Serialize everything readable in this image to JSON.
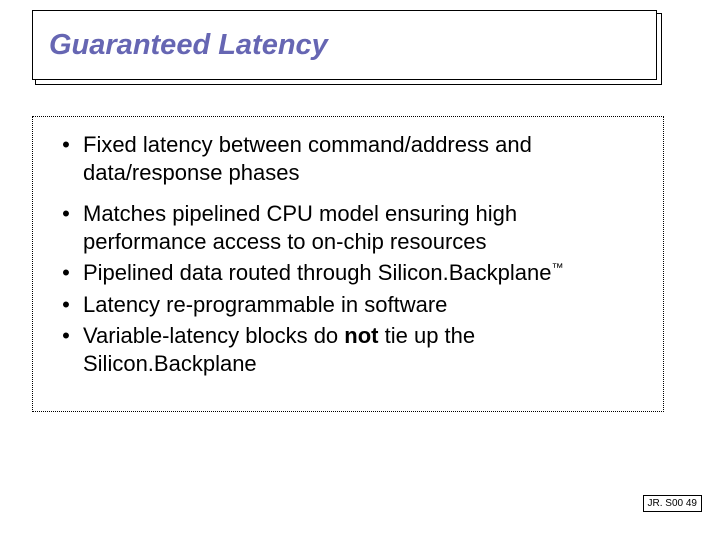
{
  "title": "Guaranteed Latency",
  "bullets": [
    {
      "pre": "Fixed latency between command/address and data/response phases",
      "bold": "",
      "post": "",
      "tm": false,
      "tight": false
    },
    {
      "pre": "Matches pipelined CPU model ensuring high performance access to on-chip resources",
      "bold": "",
      "post": "",
      "tm": false,
      "tight": true
    },
    {
      "pre": "Pipelined data routed through Silicon.Backplane",
      "bold": "",
      "post": "",
      "tm": true,
      "tight": true
    },
    {
      "pre": "Latency re-programmable in software",
      "bold": "",
      "post": "",
      "tm": false,
      "tight": true
    },
    {
      "pre": "Variable-latency blocks do ",
      "bold": "not",
      "post": " tie up the Silicon.Backplane",
      "tm": false,
      "tight": false
    }
  ],
  "footer": "JR. S00 49",
  "glyphs": {
    "bullet": "•",
    "tm": "™"
  }
}
